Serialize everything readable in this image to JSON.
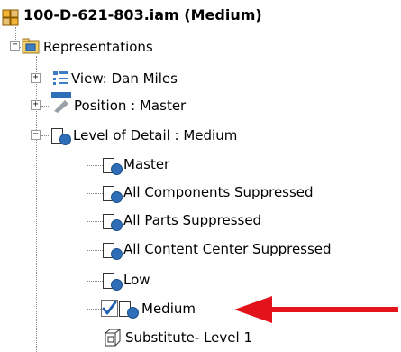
{
  "tree": {
    "root": {
      "label": "100-D-621-803.iam (Medium)",
      "icon": "assembly-icon"
    },
    "representations": {
      "label": "Representations",
      "toggle": "−"
    },
    "view": {
      "label": "View: Dan Miles",
      "toggle": "+"
    },
    "position": {
      "label": "Position : Master",
      "toggle": "+"
    },
    "level_of_detail": {
      "label": "Level of Detail : Medium",
      "toggle": "−",
      "items": [
        {
          "label": "Master"
        },
        {
          "label": "All Components Suppressed"
        },
        {
          "label": "All Parts Suppressed"
        },
        {
          "label": "All Content Center Suppressed"
        },
        {
          "label": "Low"
        },
        {
          "label": "Medium",
          "active": true
        },
        {
          "label": "Substitute- Level 1"
        }
      ]
    }
  },
  "colors": {
    "arrow": "#e3131b",
    "lod_circle": "#2f6db8",
    "checkmark": "#1f5fb0"
  }
}
